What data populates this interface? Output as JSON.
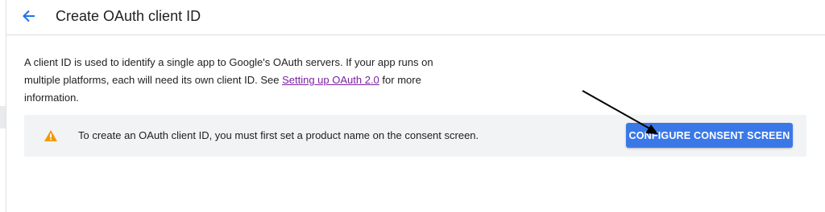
{
  "header": {
    "back_icon": "arrow-left-icon",
    "title": "Create OAuth client ID"
  },
  "intro": {
    "text_before_link": "A client ID is used to identify a single app to Google's OAuth servers. If your app runs on multiple platforms, each will need its own client ID. See ",
    "link_text": "Setting up OAuth 2.0",
    "text_after_link": " for more information."
  },
  "notice": {
    "icon": "warning-icon",
    "message": "To create an OAuth client ID, you must first set a product name on the consent screen.",
    "button_label": "CONFIGURE CONSENT SCREEN"
  },
  "annotation": {
    "icon": "annotation-arrow-icon"
  },
  "colors": {
    "accent": "#1a73e8",
    "button": "#3b78e7",
    "link": "#7b1fa2",
    "warning": "#f29900",
    "notice_bg": "#f1f3f4"
  }
}
